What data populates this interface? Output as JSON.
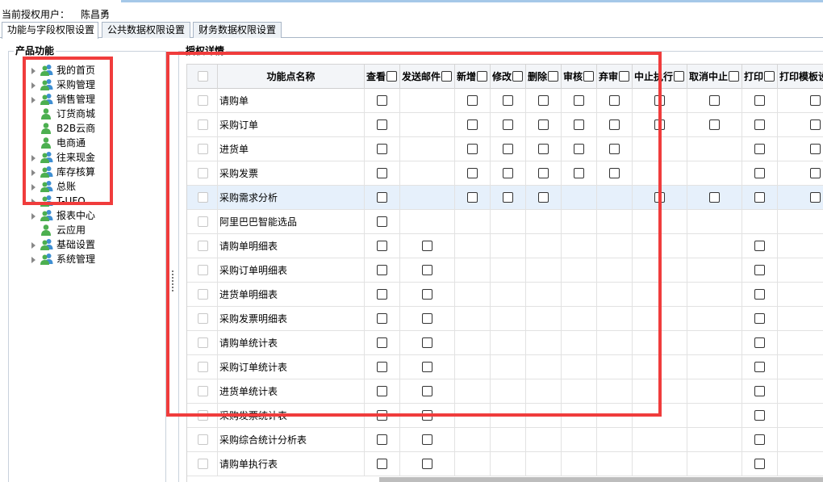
{
  "header": {
    "user_label": "当前授权用户：",
    "user_name": "陈昌勇"
  },
  "tabs": [
    {
      "label": "功能与字段权限设置",
      "active": true
    },
    {
      "label": "公共数据权限设置",
      "active": false
    },
    {
      "label": "财务数据权限设置",
      "active": false
    }
  ],
  "left_panel": {
    "legend": "产品功能",
    "tree": [
      {
        "label": "我的首页",
        "icon": "users-icon",
        "expandable": true
      },
      {
        "label": "采购管理",
        "icon": "users-icon",
        "expandable": true
      },
      {
        "label": "销售管理",
        "icon": "users-icon",
        "expandable": true
      },
      {
        "label": "订货商城",
        "icon": "user-icon",
        "expandable": false
      },
      {
        "label": "B2B云商",
        "icon": "user-icon",
        "expandable": false
      },
      {
        "label": "电商通",
        "icon": "user-icon",
        "expandable": false
      },
      {
        "label": "往来现金",
        "icon": "users-icon",
        "expandable": true
      },
      {
        "label": "库存核算",
        "icon": "users-icon",
        "expandable": true
      },
      {
        "label": "总账",
        "icon": "users-icon",
        "expandable": true
      },
      {
        "label": "T-UFO",
        "icon": "users-icon",
        "expandable": true
      },
      {
        "label": "报表中心",
        "icon": "users-icon",
        "expandable": true
      },
      {
        "label": "云应用",
        "icon": "user-icon",
        "expandable": false
      },
      {
        "label": "基础设置",
        "icon": "users-icon",
        "expandable": true
      },
      {
        "label": "系统管理",
        "icon": "users-icon",
        "expandable": true
      }
    ]
  },
  "right_panel": {
    "legend": "授权详情"
  },
  "grid": {
    "columns": [
      {
        "key": "sel",
        "label": ""
      },
      {
        "key": "name",
        "label": "功能点名称"
      },
      {
        "key": "view",
        "label": "查看"
      },
      {
        "key": "email",
        "label": "发送邮件"
      },
      {
        "key": "add",
        "label": "新增"
      },
      {
        "key": "edit",
        "label": "修改"
      },
      {
        "key": "del",
        "label": "删除"
      },
      {
        "key": "audit",
        "label": "审核"
      },
      {
        "key": "abandon",
        "label": "弃审"
      },
      {
        "key": "stop",
        "label": "中止执行"
      },
      {
        "key": "unstop",
        "label": "取消中止"
      },
      {
        "key": "print",
        "label": "打印"
      },
      {
        "key": "tpl",
        "label": "打印模板设"
      }
    ],
    "rows": [
      {
        "name": "请购单",
        "checks": {
          "view": false,
          "add": false,
          "edit": false,
          "del": false,
          "audit": false,
          "abandon": false,
          "stop": false,
          "unstop": false,
          "print": false,
          "tpl": false
        }
      },
      {
        "name": "采购订单",
        "checks": {
          "view": false,
          "add": false,
          "edit": false,
          "del": false,
          "audit": false,
          "abandon": false,
          "stop": false,
          "unstop": false,
          "print": false,
          "tpl": false
        }
      },
      {
        "name": "进货单",
        "checks": {
          "view": false,
          "add": false,
          "edit": false,
          "del": false,
          "audit": false,
          "abandon": false,
          "print": false,
          "tpl": false
        }
      },
      {
        "name": "采购发票",
        "checks": {
          "view": false,
          "add": false,
          "edit": false,
          "del": false,
          "audit": false,
          "abandon": false,
          "print": false,
          "tpl": false
        }
      },
      {
        "name": "采购需求分析",
        "selected": true,
        "checks": {
          "view": false,
          "add": false,
          "edit": false,
          "del": false,
          "stop": false,
          "unstop": false,
          "print": false,
          "tpl": false
        }
      },
      {
        "name": "阿里巴巴智能选品",
        "checks": {
          "view": false
        }
      },
      {
        "name": "请购单明细表",
        "checks": {
          "view": false,
          "email": false,
          "print": false
        }
      },
      {
        "name": "采购订单明细表",
        "checks": {
          "view": false,
          "email": false,
          "print": false
        }
      },
      {
        "name": "进货单明细表",
        "checks": {
          "view": false,
          "email": false,
          "print": false
        }
      },
      {
        "name": "采购发票明细表",
        "checks": {
          "view": false,
          "email": false,
          "print": false
        }
      },
      {
        "name": "请购单统计表",
        "checks": {
          "view": false,
          "email": false,
          "print": false
        }
      },
      {
        "name": "采购订单统计表",
        "checks": {
          "view": false,
          "email": false,
          "print": false
        }
      },
      {
        "name": "进货单统计表",
        "checks": {
          "view": false,
          "email": false,
          "print": false
        }
      },
      {
        "name": "采购发票统计表",
        "checks": {
          "view": false,
          "email": false,
          "print": false
        }
      },
      {
        "name": "采购综合统计分析表",
        "checks": {
          "view": false,
          "email": false,
          "print": false
        }
      },
      {
        "name": "请购单执行表",
        "checks": {
          "view": false,
          "email": false,
          "print": false
        }
      }
    ]
  },
  "colors": {
    "highlight": "#f03c3c",
    "selected_row": "#e6f0fb",
    "header_bg": "#f3f5f8"
  }
}
